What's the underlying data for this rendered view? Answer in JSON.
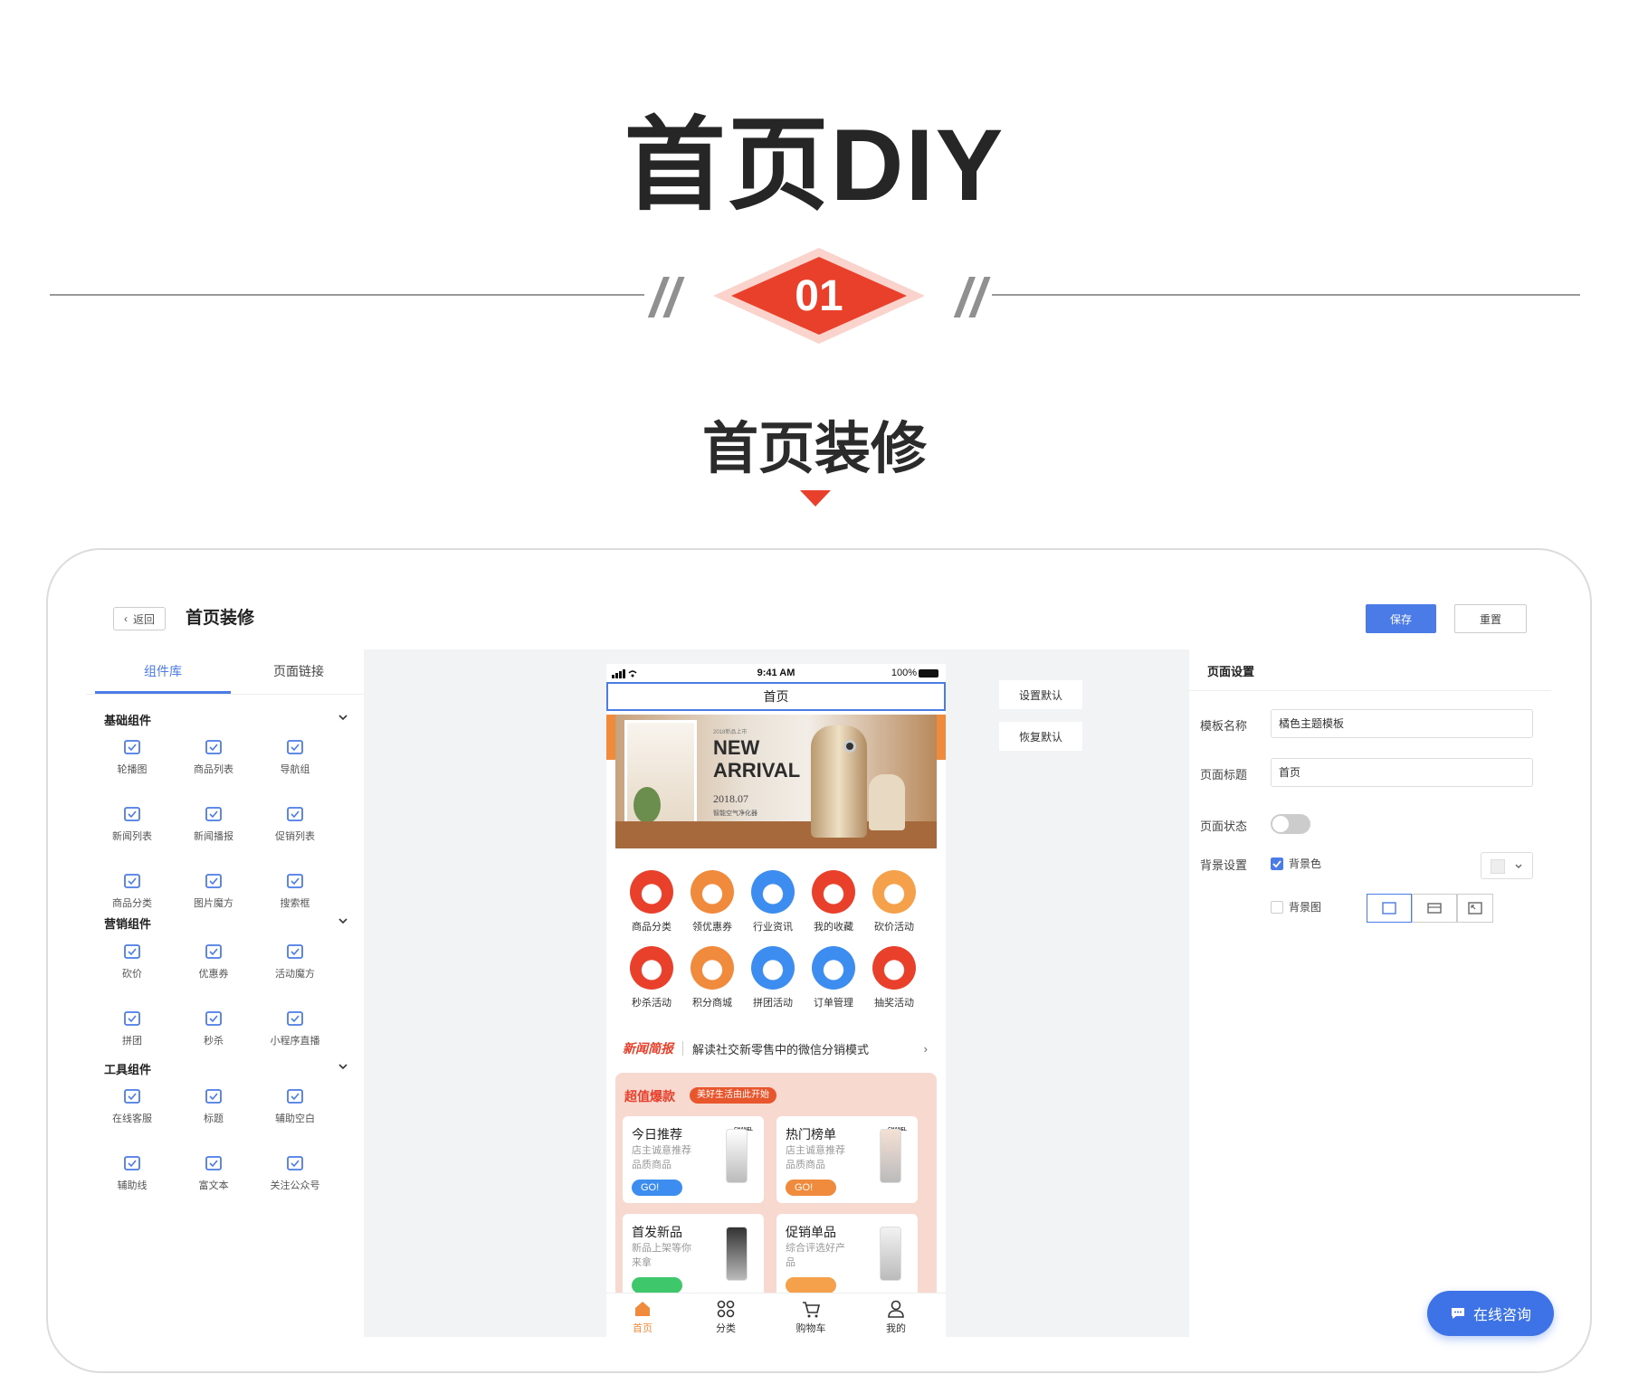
{
  "hero": {
    "title": "首页DIY",
    "number": "01",
    "subtitle": "首页装修"
  },
  "header": {
    "back_label": "返回",
    "title": "首页装修",
    "save_label": "保存",
    "reset_label": "重置"
  },
  "left_panel": {
    "tabs": [
      {
        "label": "组件库"
      },
      {
        "label": "页面链接"
      }
    ],
    "sections": [
      {
        "title": "基础组件",
        "items": [
          {
            "label": "轮播图",
            "icon": "carousel-icon"
          },
          {
            "label": "商品列表",
            "icon": "product-list-icon"
          },
          {
            "label": "导航组",
            "icon": "nav-group-icon"
          },
          {
            "label": "新闻列表",
            "icon": "news-list-icon"
          },
          {
            "label": "新闻播报",
            "icon": "news-broadcast-icon"
          },
          {
            "label": "促销列表",
            "icon": "promo-list-icon"
          },
          {
            "label": "商品分类",
            "icon": "category-icon"
          },
          {
            "label": "图片魔方",
            "icon": "image-cube-icon"
          },
          {
            "label": "搜索框",
            "icon": "search-box-icon"
          }
        ]
      },
      {
        "title": "营销组件",
        "items": [
          {
            "label": "砍价",
            "icon": "bargain-icon"
          },
          {
            "label": "优惠券",
            "icon": "coupon-icon"
          },
          {
            "label": "活动魔方",
            "icon": "activity-cube-icon"
          },
          {
            "label": "拼团",
            "icon": "group-buy-icon"
          },
          {
            "label": "秒杀",
            "icon": "flash-sale-icon"
          },
          {
            "label": "小程序直播",
            "icon": "live-icon"
          }
        ]
      },
      {
        "title": "工具组件",
        "items": [
          {
            "label": "在线客服",
            "icon": "customer-service-icon"
          },
          {
            "label": "标题",
            "icon": "title-icon"
          },
          {
            "label": "辅助空白",
            "icon": "blank-icon"
          },
          {
            "label": "辅助线",
            "icon": "guide-line-icon"
          },
          {
            "label": "富文本",
            "icon": "rich-text-icon"
          },
          {
            "label": "关注公众号",
            "icon": "follow-icon"
          }
        ]
      }
    ]
  },
  "phone": {
    "status_time": "9:41 AM",
    "status_battery": "100%",
    "title": "首页",
    "banner": {
      "small": "2018新品上市",
      "headline": "NEW\nARRIVAL",
      "date": "2018.07",
      "caption": "智能空气净化器"
    },
    "categories": [
      {
        "label": "商品分类",
        "color": "#e8402b"
      },
      {
        "label": "领优惠券",
        "color": "#f08a3c"
      },
      {
        "label": "行业资讯",
        "color": "#3d8cf0"
      },
      {
        "label": "我的收藏",
        "color": "#e8402b"
      },
      {
        "label": "砍价活动",
        "color": "#f5a04a"
      },
      {
        "label": "秒杀活动",
        "color": "#e8402b"
      },
      {
        "label": "积分商城",
        "color": "#f08a3c"
      },
      {
        "label": "拼团活动",
        "color": "#3d8cf0"
      },
      {
        "label": "订单管理",
        "color": "#3d8cf0"
      },
      {
        "label": "抽奖活动",
        "color": "#e8402b"
      }
    ],
    "news": {
      "tag": "新闻简报",
      "text": "解读社交新零售中的微信分销模式",
      "arrow": "›"
    },
    "promo": {
      "title": "超值爆款",
      "badge": "美好生活由此开始",
      "cards": [
        {
          "title": "今日推荐",
          "desc": "店主诚意推荐 品质商品",
          "go": "GO!",
          "go_color": "#3d8cf0",
          "brand": "CHANEL"
        },
        {
          "title": "热门榜单",
          "desc": "店主诚意推荐 品质商品",
          "go": "GO!",
          "go_color": "#f08a3c",
          "brand": "CHANEL"
        },
        {
          "title": "首发新品",
          "desc": "新品上架等你来拿",
          "go": "",
          "go_color": "#3ec86b",
          "brand": ""
        },
        {
          "title": "促销单品",
          "desc": "综合评选好产品",
          "go": "",
          "go_color": "#f5a04a",
          "brand": ""
        }
      ]
    },
    "tabbar": [
      {
        "label": "首页",
        "icon": "home-icon"
      },
      {
        "label": "分类",
        "icon": "category-grid-icon"
      },
      {
        "label": "购物车",
        "icon": "cart-icon"
      },
      {
        "label": "我的",
        "icon": "user-icon"
      }
    ]
  },
  "side_buttons": {
    "set_default": "设置默认",
    "restore_default": "恢复默认"
  },
  "right_panel": {
    "title": "页面设置",
    "template_name_label": "模板名称",
    "template_name_value": "橘色主题模板",
    "page_title_label": "页面标题",
    "page_title_value": "首页",
    "page_status_label": "页面状态",
    "page_status_on": false,
    "bg_label": "背景设置",
    "bg_color_label": "背景色",
    "bg_color_checked": true,
    "bg_image_label": "背景图",
    "bg_image_checked": false
  },
  "chat": {
    "label": "在线咨询"
  },
  "colors": {
    "accent": "#4b7be6",
    "red": "#e8402b",
    "orange": "#f08a3c"
  }
}
